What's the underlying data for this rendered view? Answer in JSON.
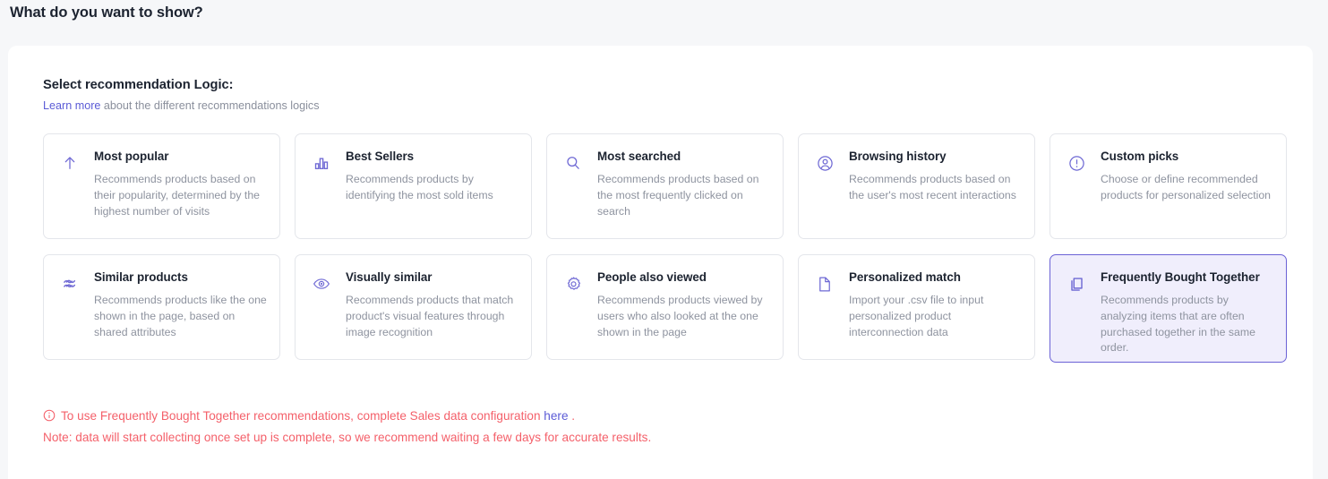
{
  "page": {
    "heading": "What do you want to show?"
  },
  "section": {
    "title": "Select recommendation Logic:",
    "sub_link": "Learn more",
    "sub_text": " about the different recommendations logics"
  },
  "colors": {
    "accent": "#6e68d4",
    "selected_border": "#6b62d6",
    "selected_bg": "#f0eefc",
    "link": "#5b5bd6",
    "warning": "#f4606a",
    "page_bg": "#f6f7f9",
    "panel_bg": "#ffffff",
    "card_border": "#e4e6eb",
    "title_text": "#1c2330",
    "muted_text": "#8e939f"
  },
  "cards": [
    {
      "id": "most-popular",
      "icon": "arrow-up-icon",
      "title": "Most popular",
      "description": "Recommends products based on their popularity, determined by the highest number of visits",
      "selected": false
    },
    {
      "id": "best-sellers",
      "icon": "bar-chart-icon",
      "title": "Best Sellers",
      "description": "Recommends products by identifying the most sold items",
      "selected": false
    },
    {
      "id": "most-searched",
      "icon": "search-icon",
      "title": "Most searched",
      "description": "Recommends products based on the most frequently clicked on search",
      "selected": false
    },
    {
      "id": "browsing-history",
      "icon": "user-circle-icon",
      "title": "Browsing history",
      "description": "Recommends products based on the user's most recent interactions",
      "selected": false
    },
    {
      "id": "custom-picks",
      "icon": "exclamation-circle-icon",
      "title": "Custom picks",
      "description": "Choose or define recommended products for personalized selection",
      "selected": false
    },
    {
      "id": "similar-products",
      "icon": "approximately-equal-icon",
      "title": "Similar products",
      "description": "Recommends products like the one shown in the page, based on shared attributes",
      "selected": false
    },
    {
      "id": "visually-similar",
      "icon": "eye-icon",
      "title": "Visually similar",
      "description": "Recommends products that match product's visual features through image recognition",
      "selected": false
    },
    {
      "id": "people-also-viewed",
      "icon": "gear-icon",
      "title": "People also viewed",
      "description": "Recommends products viewed by users who also looked at the one shown in the page",
      "selected": false
    },
    {
      "id": "personalized-match",
      "icon": "file-icon",
      "title": "Personalized match",
      "description": "Import your .csv file to input personalized product interconnection data",
      "selected": false
    },
    {
      "id": "frequently-bought-together",
      "icon": "copy-icon",
      "title": "Frequently Bought Together",
      "description": "Recommends products by analyzing items that are often purchased together in the same order.",
      "selected": true
    }
  ],
  "note": {
    "icon": "info-circle-icon",
    "line1_before": "To use Frequently Bought Together recommendations, complete Sales data configuration ",
    "line1_link": "here",
    "line1_after": " .",
    "line2": "Note: data will start collecting once set up is complete, so we recommend waiting a few days for accurate results."
  }
}
